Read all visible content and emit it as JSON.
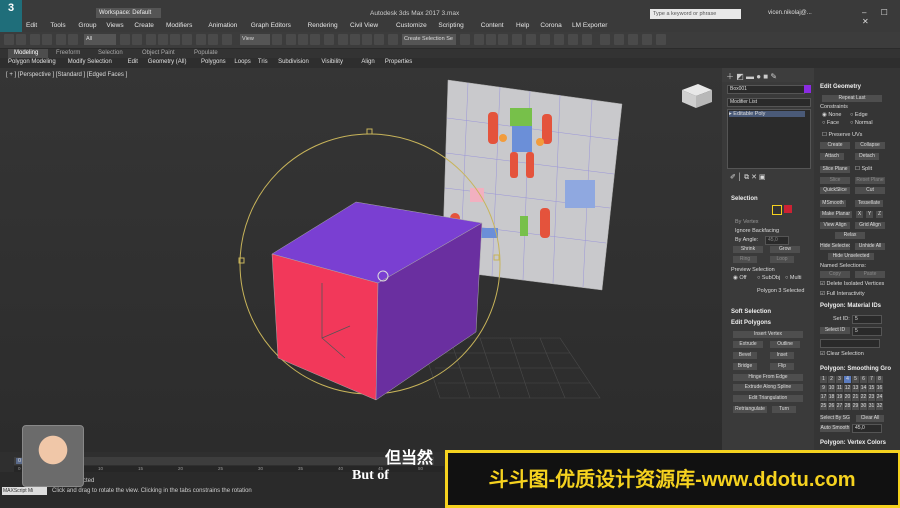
{
  "window": {
    "app_icon_label": "3",
    "doc_title": "Autodesk 3ds Max 2017    3.max",
    "workspace_label": "Workspace: Default",
    "search_placeholder": "Type a keyword or phrase",
    "user": "vicen.nikolaj@...",
    "controls": "– ☐ ✕"
  },
  "menu": [
    "Edit",
    "Tools",
    "Group",
    "Views",
    "Create",
    "Modifiers",
    "Animation",
    "Graph Editors",
    "Rendering",
    "Civil View",
    "Customize",
    "Scripting",
    "Content",
    "Help",
    "Corona",
    "LM Exporter"
  ],
  "toolbar": {
    "filter_select": "All",
    "view_select": "View",
    "selection_set": "Create Selection Se"
  },
  "ribbon": {
    "tabs": [
      "Modeling",
      "Freeform",
      "Selection",
      "Object Paint",
      "Populate"
    ],
    "items": [
      "Polygon Modeling",
      "Modify Selection",
      "Edit",
      "Geometry (All)",
      "Polygons",
      "Loops",
      "Tris",
      "Subdivision",
      "Visibility",
      "Align",
      "Properties"
    ]
  },
  "viewport": {
    "label": "[ + ] [Perspective ] [Standard ] [Edged Faces ]"
  },
  "command_panel": {
    "object_name": "Box001",
    "modifier_list": "Modifier List",
    "stack_item": "Editable Poly",
    "selection": {
      "title": "Selection",
      "by_vertex": "By Vertex",
      "ignore_backfacing": "Ignore Backfacing",
      "by_angle": "By Angle:",
      "angle_value": "45,0",
      "shrink": "Shrink",
      "grow": "Grow",
      "ring": "Ring",
      "loop": "Loop",
      "preview_selection": "Preview Selection",
      "off": "Off",
      "subobj": "SubObj",
      "multi": "Multi",
      "status": "Polygon 3 Selected"
    },
    "soft_selection": "Soft Selection",
    "edit_polygons": {
      "title": "Edit Polygons",
      "insert_vertex": "Insert Vertex",
      "extrude": "Extrude",
      "outline": "Outline",
      "bevel": "Bevel",
      "inset": "Inset",
      "bridge": "Bridge",
      "flip": "Flip",
      "hinge": "Hinge From Edge",
      "extrude_spline": "Extrude Along Spline",
      "edit_triangulation": "Edit Triangulation",
      "retriangulate": "Retriangulate",
      "turn": "Turn"
    }
  },
  "right_panel": {
    "edit_geometry": {
      "title": "Edit Geometry",
      "repeat_last": "Repeat Last",
      "constraints": "Constraints",
      "none": "None",
      "edge": "Edge",
      "face": "Face",
      "normal": "Normal",
      "preserve_uvs": "Preserve UVs",
      "create": "Create",
      "collapse": "Collapse",
      "attach": "Attach",
      "detach": "Detach",
      "slice_plane": "Slice Plane",
      "split": "Split",
      "slice": "Slice",
      "reset_plane": "Reset Plane",
      "quickslice": "QuickSlice",
      "cut": "Cut",
      "msmooth": "MSmooth",
      "tessellate": "Tessellate",
      "make_planar": "Make Planar",
      "x": "X",
      "y": "Y",
      "z": "Z",
      "view_align": "View Align",
      "grid_align": "Grid Align",
      "relax": "Relax",
      "hide_selected": "Hide Selected",
      "unhide_all": "Unhide All",
      "hide_unselected": "Hide Unselected",
      "named_selections": "Named Selections:",
      "copy": "Copy",
      "paste": "Paste",
      "delete_isolated": "Delete Isolated Vertices",
      "full_interactivity": "Full Interactivity"
    },
    "material_ids": {
      "title": "Polygon: Material IDs",
      "set_id": "Set ID:",
      "set_id_value": "5",
      "select_id": "Select ID",
      "select_id_value": "5",
      "clear_selection": "Clear Selection"
    },
    "smoothing": {
      "title": "Polygon: Smoothing Gro",
      "groups": [
        "1",
        "2",
        "3",
        "4",
        "5",
        "6",
        "7",
        "8",
        "9",
        "10",
        "11",
        "12",
        "13",
        "14",
        "15",
        "16",
        "17",
        "18",
        "19",
        "20",
        "21",
        "22",
        "23",
        "24",
        "25",
        "26",
        "27",
        "28",
        "29",
        "30",
        "31",
        "32"
      ],
      "select_by_sg": "Select By SG",
      "clear_all": "Clear All",
      "auto_smooth": "Auto Smooth",
      "auto_smooth_value": "45,0"
    },
    "vertex_colors": "Polygon: Vertex Colors"
  },
  "timeline": {
    "frame": "0 / 100",
    "ticks": [
      "0",
      "5",
      "10",
      "15",
      "20",
      "25",
      "30",
      "35",
      "40",
      "45",
      "50"
    ]
  },
  "status": {
    "maxscript": "MAXScript Mi",
    "line1": "Object Selected",
    "line2": "Click and drag to rotate the view.  Clicking in the tabs constrains the rotation"
  },
  "overlay": {
    "subtitle_cn": "但当然",
    "subtitle_en": "But of",
    "banner": "斗斗图-优质设计资源库-www.ddotu.com"
  },
  "colors": {
    "cube_front": "#f2385a",
    "cube_side": "#6a2fa0",
    "cube_top": "#7a3fd2",
    "gizmo": "#c8b45a",
    "accent": "#f5d21f"
  }
}
